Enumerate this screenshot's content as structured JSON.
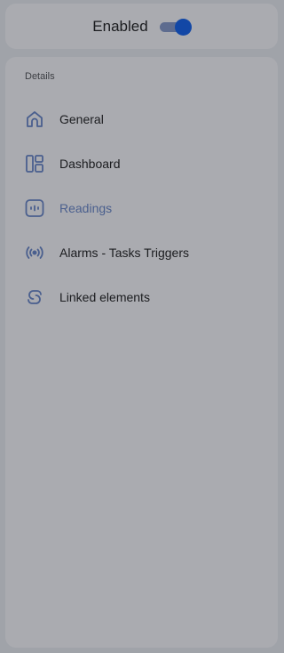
{
  "header": {
    "enabled_label": "Enabled",
    "enabled": true
  },
  "details": {
    "section_title": "Details",
    "items": [
      {
        "label": "General",
        "icon": "home-icon",
        "active": false
      },
      {
        "label": "Dashboard",
        "icon": "dashboard-icon",
        "active": false
      },
      {
        "label": "Readings",
        "icon": "readings-icon",
        "active": true
      },
      {
        "label": "Alarms - Tasks Triggers",
        "icon": "broadcast-icon",
        "active": false
      },
      {
        "label": "Linked elements",
        "icon": "link-icon",
        "active": false
      }
    ]
  },
  "colors": {
    "accent": "#4a5f8e",
    "toggle_knob": "#1247a6",
    "panel_bg": "#aaabb0",
    "page_bg": "#a0a3a9"
  }
}
